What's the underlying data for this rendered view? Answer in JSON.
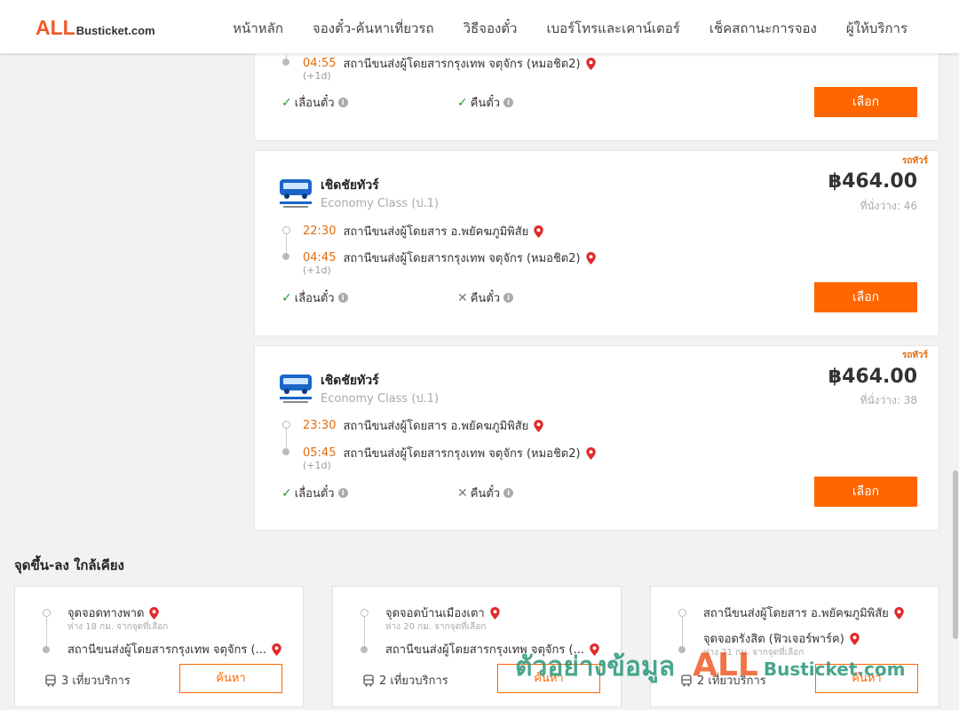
{
  "header": {
    "logo_all": "ALL",
    "logo_rest": "Busticket.com",
    "nav": [
      "หน้าหลัก",
      "จองตั๋ว-ค้นหาเที่ยวรถ",
      "วิธีจองตั๋ว",
      "เบอร์โทรและเคาน์เตอร์",
      "เช็คสถานะการจอง",
      "ผู้ให้บริการ"
    ]
  },
  "card0": {
    "arrive_time": "04:55",
    "arrive_station": "สถานีขนส่งผู้โดยสารกรุงเทพ จตุจักร (หมอชิต2)",
    "plus_day": "(+1d)",
    "option1": "เลื่อนตั๋ว",
    "option2": "คืนตั๋ว",
    "select": "เลือก"
  },
  "card1": {
    "tag": "รถทัวร์",
    "operator": "เชิดชัยทัวร์",
    "class": "Economy Class (ป.1)",
    "price": "฿464.00",
    "seats": "ที่นั่งว่าง: 46",
    "depart_time": "22:30",
    "depart_station": "สถานีขนส่งผู้โดยสาร อ.พยัคฆภูมิพิสัย",
    "arrive_time": "04:45",
    "arrive_station": "สถานีขนส่งผู้โดยสารกรุงเทพ จตุจักร (หมอชิต2)",
    "plus_day": "(+1d)",
    "option1": "เลื่อนตั๋ว",
    "option2": "คืนตั๋ว",
    "select": "เลือก"
  },
  "card2": {
    "tag": "รถทัวร์",
    "operator": "เชิดชัยทัวร์",
    "class": "Economy Class (ป.1)",
    "price": "฿464.00",
    "seats": "ที่นั่งว่าง: 38",
    "depart_time": "23:30",
    "depart_station": "สถานีขนส่งผู้โดยสาร อ.พยัคฆภูมิพิสัย",
    "arrive_time": "05:45",
    "arrive_station": "สถานีขนส่งผู้โดยสารกรุงเทพ จตุจักร (หมอชิต2)",
    "plus_day": "(+1d)",
    "option1": "เลื่อนตั๋ว",
    "option2": "คืนตั๋ว",
    "select": "เลือก"
  },
  "nearby": {
    "title": "จุดขึ้น-ลง ใกล้เคียง",
    "cards": [
      {
        "from": "จุดจอดทางพาด",
        "from_dist": "ห่าง 18 กม. จากจุดที่เลือก",
        "to": "สถานีขนส่งผู้โดยสารกรุงเทพ จตุจักร (...",
        "to_dist": "",
        "trips": "3 เที่ยวบริการ",
        "button": "ค้นหา"
      },
      {
        "from": "จุดจอดบ้านเมืองเตา",
        "from_dist": "ห่าง 20 กม. จากจุดที่เลือก",
        "to": "สถานีขนส่งผู้โดยสารกรุงเทพ จตุจักร (...",
        "to_dist": "",
        "trips": "2 เที่ยวบริการ",
        "button": "ค้นหา"
      },
      {
        "from": "สถานีขนส่งผู้โดยสาร อ.พยัคฆภูมิพิสัย",
        "from_dist": "",
        "to": "จุดจอดรังสิต (ฟิวเจอร์พาร์ค)",
        "to_dist": "ห่าง 21 กม. จากจุดที่เลือก",
        "trips": "2 เที่ยวบริการ",
        "button": "ค้นหา"
      }
    ]
  },
  "watermark": {
    "text": "ตัวอย่างข้อมูล",
    "all": "ALL",
    "rest": "Busticket.com"
  },
  "colors": {
    "accent": "#ff6600",
    "time": "#e36b0a",
    "check": "#2b9a3b",
    "logo": "#f05a28"
  }
}
